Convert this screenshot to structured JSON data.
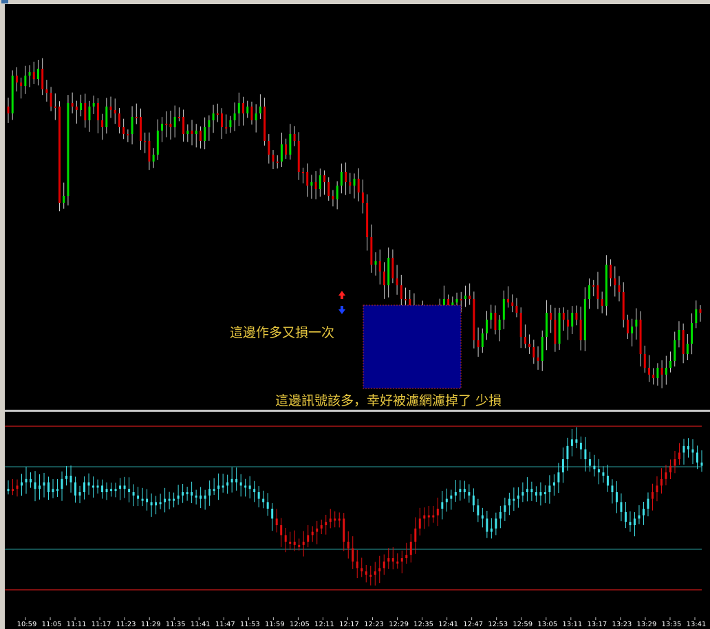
{
  "annotations": {
    "note1": "這邊作多又損一次",
    "note2": "這邊訊號該多，幸好被濾網濾掉了 少損"
  },
  "colors": {
    "background": "#000000",
    "bull": "#00e000",
    "bear": "#e00000",
    "osc_bull": "#40e0e8",
    "osc_bear": "#e01010",
    "ref_line_red": "#ff2020",
    "ref_line_teal": "#2aa0a0",
    "highlight_box": "#00008c",
    "annotation_text": "#e8c840"
  },
  "icons": [
    "red-up-arrow-icon",
    "blue-down-arrow-icon"
  ],
  "chart_data": [
    {
      "type": "candlestick",
      "title": "",
      "x_tick_labels": [
        "10:59",
        "11:05",
        "11:11",
        "11:17",
        "11:23",
        "11:29",
        "11:35",
        "11:41",
        "11:47",
        "11:53",
        "11:59",
        "12:05",
        "12:11",
        "12:17",
        "12:23",
        "12:29",
        "12:35",
        "12:41",
        "12:47",
        "12:53",
        "12:59",
        "13:05",
        "13:11",
        "13:17",
        "13:23",
        "13:29",
        "13:35",
        "13:41"
      ],
      "close": [
        170,
        115,
        125,
        130,
        115,
        110,
        120,
        105,
        135,
        140,
        160,
        160,
        300,
        290,
        155,
        160,
        165,
        155,
        180,
        160,
        155,
        180,
        190,
        160,
        165,
        170,
        190,
        200,
        200,
        175,
        175,
        210,
        210,
        240,
        230,
        195,
        185,
        185,
        190,
        175,
        175,
        200,
        195,
        200,
        195,
        210,
        190,
        180,
        170,
        170,
        190,
        190,
        180,
        170,
        155,
        170,
        160,
        180,
        170,
        160,
        210,
        230,
        240,
        240,
        215,
        230,
        200,
        210,
        255,
        255,
        275,
        270,
        280,
        260,
        270,
        290,
        295,
        275,
        255,
        270,
        275,
        265,
        285,
        300,
        350,
        390,
        385,
        400,
        420,
        380,
        410,
        420,
        440,
        440,
        450,
        460,
        455,
        480,
        490,
        470,
        465,
        450,
        440,
        450,
        445,
        440,
        440,
        435,
        440,
        500,
        510,
        490,
        470,
        460,
        485,
        470,
        440,
        445,
        450,
        460,
        495,
        505,
        510,
        525,
        530,
        495,
        460,
        470,
        505,
        460,
        470,
        480,
        460,
        470,
        500,
        440,
        420,
        420,
        440,
        450,
        390,
        410,
        420,
        430,
        470,
        490,
        480,
        470,
        520,
        540,
        550,
        555,
        540,
        550,
        540,
        530,
        500,
        485,
        520,
        505,
        475,
        455,
        460
      ],
      "volume_like_levels": [],
      "period": "1 minute bars"
    },
    {
      "type": "oscillator",
      "title": "",
      "reference_lines": [
        "upper-red",
        "upper-teal",
        "mid-teal",
        "lower-red"
      ],
      "values": [
        62,
        62,
        64,
        66,
        68,
        66,
        62,
        64,
        66,
        60,
        62,
        62,
        68,
        70,
        66,
        58,
        60,
        66,
        64,
        64,
        64,
        60,
        62,
        62,
        62,
        64,
        62,
        60,
        58,
        56,
        56,
        54,
        52,
        54,
        54,
        56,
        56,
        56,
        58,
        60,
        60,
        58,
        58,
        56,
        58,
        62,
        62,
        64,
        64,
        66,
        68,
        66,
        64,
        64,
        62,
        60,
        56,
        54,
        50,
        44,
        40,
        34,
        30,
        30,
        28,
        28,
        30,
        34,
        36,
        38,
        40,
        42,
        44,
        44,
        44,
        30,
        26,
        18,
        14,
        12,
        10,
        10,
        12,
        14,
        18,
        20,
        18,
        18,
        20,
        22,
        30,
        38,
        44,
        46,
        46,
        46,
        50,
        54,
        56,
        58,
        60,
        62,
        60,
        58,
        52,
        46,
        44,
        36,
        38,
        44,
        48,
        52,
        56,
        56,
        58,
        60,
        62,
        60,
        58,
        60,
        60,
        64,
        66,
        72,
        80,
        88,
        92,
        90,
        86,
        80,
        76,
        74,
        72,
        70,
        64,
        60,
        54,
        48,
        42,
        40,
        44,
        46,
        50,
        56,
        60,
        64,
        68,
        72,
        76,
        80,
        84,
        88,
        86,
        84,
        78,
        76
      ],
      "bear_ranges": [
        [
          1,
          2
        ],
        [
          60,
          96
        ],
        [
          144,
          150
        ]
      ]
    }
  ]
}
